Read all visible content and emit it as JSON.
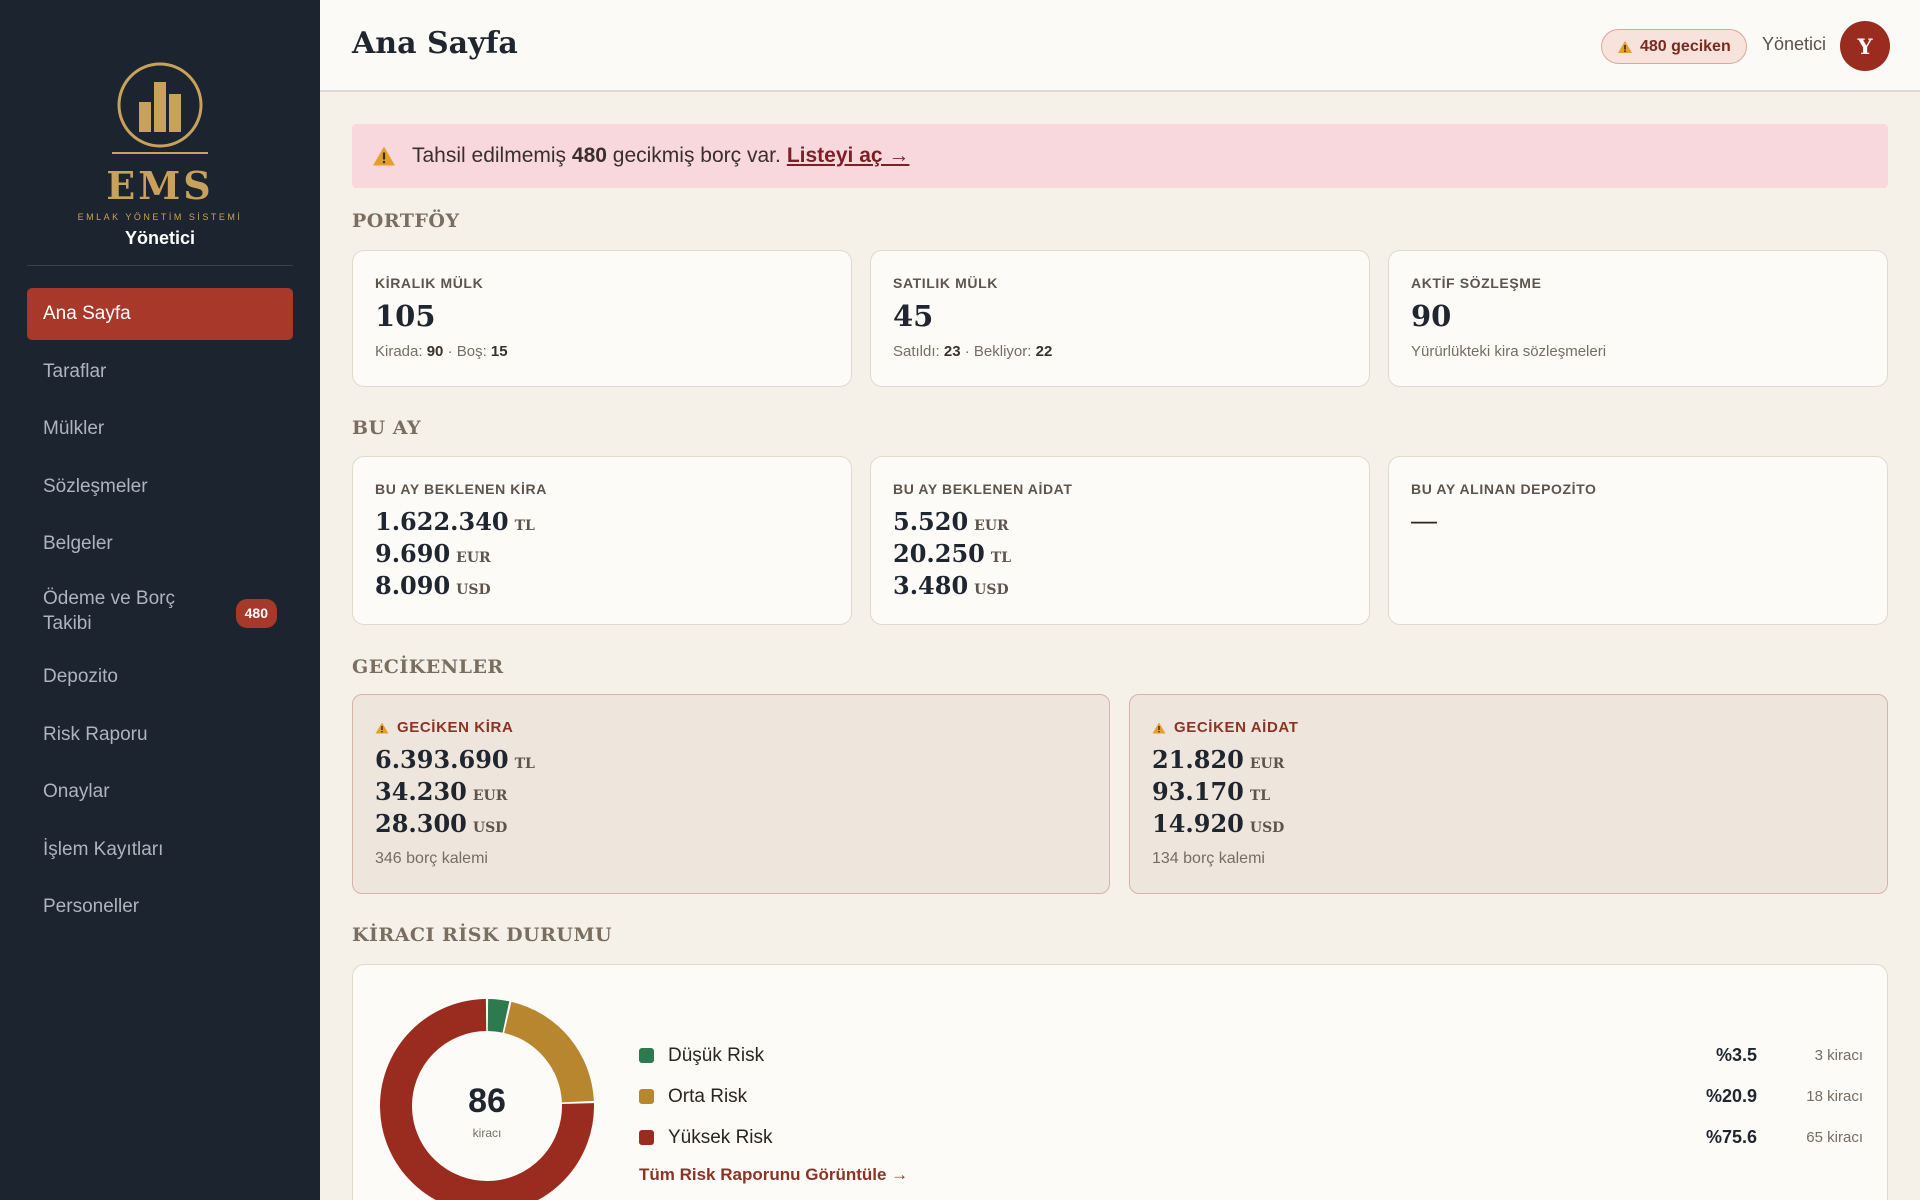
{
  "colors": {
    "sidebar": "#1c2430",
    "accent": "#a8382a",
    "gold": "#c8a25a",
    "low": "#2e7a4f",
    "mid": "#b8862f",
    "high": "#992c1f"
  },
  "sidebar": {
    "brand_name": "EMS",
    "brand_sub": "EMLAK YÖNETİM SİSTEMİ",
    "role": "Yönetici",
    "items": [
      {
        "label": "Ana Sayfa",
        "active": true
      },
      {
        "label": "Taraflar"
      },
      {
        "label": "Mülkler"
      },
      {
        "label": "Sözleşmeler"
      },
      {
        "label": "Belgeler"
      },
      {
        "label": "Ödeme ve Borç Takibi",
        "badge": "480"
      },
      {
        "label": "Depozito"
      },
      {
        "label": "Risk Raporu"
      },
      {
        "label": "Onaylar"
      },
      {
        "label": "İşlem Kayıtları"
      },
      {
        "label": "Personeller"
      }
    ]
  },
  "header": {
    "title": "Ana Sayfa",
    "late_pill": "480 geciken",
    "user": "Yönetici",
    "avatar_letter": "Y"
  },
  "alert": {
    "prefix": "Tahsil edilmemiş",
    "count": "480",
    "suffix": "gecikmiş borç var.",
    "link": "Listeyi aç →"
  },
  "portfolio": {
    "title": "PORTFÖY",
    "rent": {
      "label": "KİRALIK MÜLK",
      "value": "105",
      "sub_a_label": "Kirada:",
      "sub_a": "90",
      "sep": "·",
      "sub_b_label": "Boş:",
      "sub_b": "15"
    },
    "sale": {
      "label": "SATILIK MÜLK",
      "value": "45",
      "sub_a_label": "Satıldı:",
      "sub_a": "23",
      "sep": "·",
      "sub_b_label": "Bekliyor:",
      "sub_b": "22"
    },
    "contracts": {
      "label": "AKTİF SÖZLEŞME",
      "value": "90",
      "sub": "Yürürlükteki kira sözleşmeleri"
    }
  },
  "month": {
    "title": "BU AY",
    "rent": {
      "label": "BU AY BEKLENEN KİRA",
      "lines": [
        {
          "value": "1.622.340",
          "cur": "TL"
        },
        {
          "value": "9.690",
          "cur": "EUR"
        },
        {
          "value": "8.090",
          "cur": "USD"
        }
      ]
    },
    "dues": {
      "label": "BU AY BEKLENEN AİDAT",
      "lines": [
        {
          "value": "5.520",
          "cur": "EUR"
        },
        {
          "value": "20.250",
          "cur": "TL"
        },
        {
          "value": "3.480",
          "cur": "USD"
        }
      ]
    },
    "deposit": {
      "label": "BU AY ALINAN DEPOZİTO",
      "value": "—"
    }
  },
  "late": {
    "title": "GECİKENLER",
    "rent": {
      "label": "GECİKEN KİRA",
      "lines": [
        {
          "value": "6.393.690",
          "cur": "TL"
        },
        {
          "value": "34.230",
          "cur": "EUR"
        },
        {
          "value": "28.300",
          "cur": "USD"
        }
      ],
      "foot": "346 borç kalemi"
    },
    "dues": {
      "label": "GECİKEN AİDAT",
      "lines": [
        {
          "value": "21.820",
          "cur": "EUR"
        },
        {
          "value": "93.170",
          "cur": "TL"
        },
        {
          "value": "14.920",
          "cur": "USD"
        }
      ],
      "foot": "134 borç kalemi"
    }
  },
  "risk": {
    "title": "KİRACI RİSK DURUMU",
    "total": "86",
    "total_label": "kiracı",
    "items": [
      {
        "name": "Düşük Risk",
        "pct": "%3.5",
        "count": "3 kiracı",
        "color": "#2e7a4f",
        "share": 3.5
      },
      {
        "name": "Orta Risk",
        "pct": "%20.9",
        "count": "18 kiracı",
        "color": "#b8862f",
        "share": 20.9
      },
      {
        "name": "Yüksek Risk",
        "pct": "%75.6",
        "count": "65 kiracı",
        "color": "#992c1f",
        "share": 75.6
      }
    ],
    "link": "Tüm Risk Raporunu Görüntüle →"
  }
}
